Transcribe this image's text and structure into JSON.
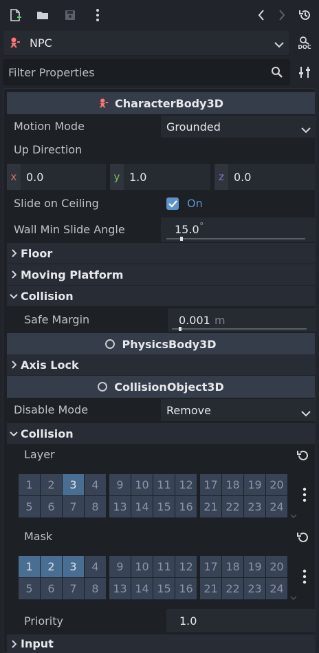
{
  "toolbar": {
    "icons": [
      "new-script-icon",
      "open-folder-icon",
      "save-icon",
      "more-icon",
      "history-back-icon",
      "history-forward-icon",
      "history-icon"
    ]
  },
  "node": {
    "name": "NPC",
    "doc_label": "DOC"
  },
  "filter": {
    "placeholder": "Filter Properties"
  },
  "categories": {
    "character": "CharacterBody3D",
    "physics": "PhysicsBody3D",
    "collision_object": "CollisionObject3D"
  },
  "props": {
    "motion_mode": {
      "label": "Motion Mode",
      "value": "Grounded"
    },
    "up_direction": {
      "label": "Up Direction",
      "x_label": "x",
      "x": "0.0",
      "y_label": "y",
      "y": "1.0",
      "z_label": "z",
      "z": "0.0"
    },
    "slide_on_ceiling": {
      "label": "Slide on Ceiling",
      "value": "On",
      "checked": true
    },
    "wall_min_slide_angle": {
      "label": "Wall Min Slide Angle",
      "value": "15.0",
      "unit": "°",
      "fraction": 0.1
    },
    "safe_margin": {
      "label": "Safe Margin",
      "value": "0.001",
      "unit": "m",
      "fraction": 0.05
    },
    "disable_mode": {
      "label": "Disable Mode",
      "value": "Remove"
    },
    "priority": {
      "label": "Priority",
      "value": "1.0"
    }
  },
  "sections": {
    "floor": "Floor",
    "moving_platform": "Moving Platform",
    "collision": "Collision",
    "axis_lock": "Axis Lock",
    "collision2": "Collision",
    "input": "Input"
  },
  "layer": {
    "label": "Layer",
    "active": [
      3
    ]
  },
  "mask": {
    "label": "Mask",
    "active": [
      1,
      2,
      3
    ]
  },
  "grid_numbers": [
    [
      "1",
      "2",
      "3",
      "4",
      "5",
      "6",
      "7",
      "8"
    ],
    [
      "9",
      "10",
      "11",
      "12",
      "13",
      "14",
      "15",
      "16"
    ],
    [
      "17",
      "18",
      "19",
      "20",
      "21",
      "22",
      "23",
      "24"
    ]
  ],
  "colors": {
    "axis_x": "#d66e6e",
    "axis_y": "#7fbf5f",
    "axis_z": "#7e7ac4",
    "accent": "#5d93c9",
    "node_icon": "#ff7474"
  }
}
